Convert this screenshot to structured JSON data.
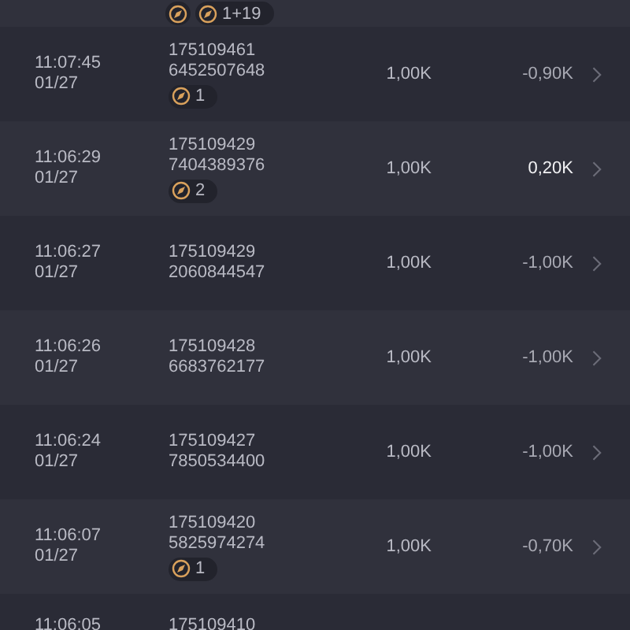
{
  "top_row": {
    "badges": [
      {
        "kind": "icon"
      },
      {
        "kind": "counted",
        "count": "1+19"
      }
    ]
  },
  "rows": [
    {
      "time": "11:07:45",
      "date": "01/27",
      "id_lines": [
        "175109461",
        "6452507648"
      ],
      "badge": "1",
      "amount": "1,00K",
      "result": "-0,90K",
      "positive": false
    },
    {
      "time": "11:06:29",
      "date": "01/27",
      "id_lines": [
        "175109429",
        "7404389376"
      ],
      "badge": "2",
      "amount": "1,00K",
      "result": "0,20K",
      "positive": true
    },
    {
      "time": "11:06:27",
      "date": "01/27",
      "id_lines": [
        "175109429",
        "2060844547"
      ],
      "amount": "1,00K",
      "result": "-1,00K",
      "positive": false
    },
    {
      "time": "11:06:26",
      "date": "01/27",
      "id_lines": [
        "175109428",
        "6683762177"
      ],
      "amount": "1,00K",
      "result": "-1,00K",
      "positive": false
    },
    {
      "time": "11:06:24",
      "date": "01/27",
      "id_lines": [
        "175109427",
        "7850534400"
      ],
      "amount": "1,00K",
      "result": "-1,00K",
      "positive": false
    },
    {
      "time": "11:06:07",
      "date": "01/27",
      "id_lines": [
        "175109420",
        "5825974274"
      ],
      "badge": "1",
      "amount": "1,00K",
      "result": "-0,70K",
      "positive": false
    }
  ],
  "bottom_row": {
    "time": "11:06:05",
    "id_line": "175109410"
  }
}
